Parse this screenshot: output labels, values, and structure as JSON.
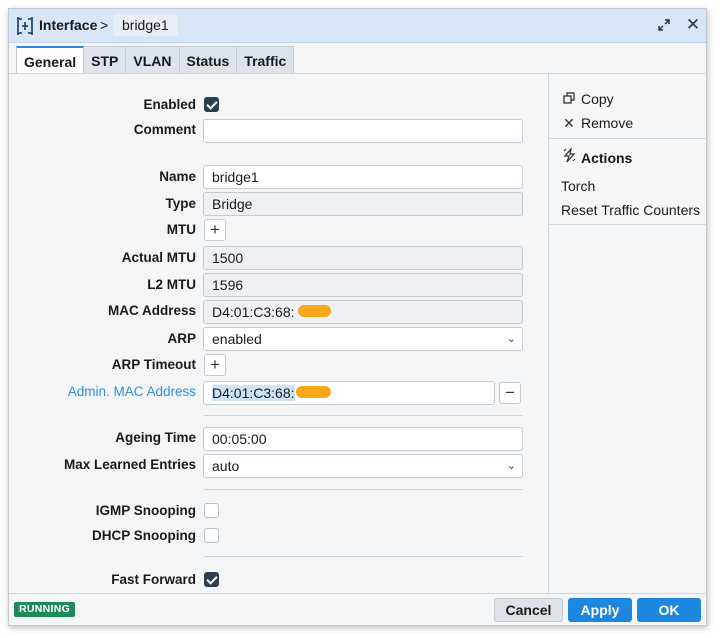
{
  "titlebar": {
    "title": "Interface",
    "separator": ">",
    "item": "bridge1",
    "icon": "interface-icon",
    "expand_icon": "expand-icon",
    "close_icon": "close-icon"
  },
  "tabs": [
    {
      "label": "General",
      "active": true
    },
    {
      "label": "STP",
      "active": false
    },
    {
      "label": "VLAN",
      "active": false
    },
    {
      "label": "Status",
      "active": false
    },
    {
      "label": "Traffic",
      "active": false
    }
  ],
  "form": {
    "enabled": {
      "label": "Enabled",
      "checked": true
    },
    "comment": {
      "label": "Comment",
      "value": ""
    },
    "name": {
      "label": "Name",
      "value": "bridge1"
    },
    "type": {
      "label": "Type",
      "value": "Bridge"
    },
    "mtu": {
      "label": "MTU",
      "button": "+"
    },
    "actual_mtu": {
      "label": "Actual MTU",
      "value": "1500"
    },
    "l2_mtu": {
      "label": "L2 MTU",
      "value": "1596"
    },
    "mac_address": {
      "label": "MAC Address",
      "value": "D4:01:C3:68:"
    },
    "arp": {
      "label": "ARP",
      "value": "enabled",
      "arrow": "⌄"
    },
    "arp_timeout": {
      "label": "ARP Timeout",
      "button": "+"
    },
    "admin_mac": {
      "label": "Admin. MAC Address",
      "value": "D4:01:C3:68:",
      "button": "−"
    },
    "ageing_time": {
      "label": "Ageing Time",
      "value": "00:05:00"
    },
    "max_learned": {
      "label": "Max Learned Entries",
      "value": "auto",
      "arrow": "⌄"
    },
    "igmp": {
      "label": "IGMP Snooping",
      "checked": false
    },
    "dhcp": {
      "label": "DHCP Snooping",
      "checked": false
    },
    "fast_forward": {
      "label": "Fast Forward",
      "checked": true
    }
  },
  "side": {
    "copy": {
      "label": "Copy",
      "icon": "copy-icon"
    },
    "remove": {
      "label": "Remove",
      "icon": "close-icon"
    },
    "actions_heading": {
      "label": "Actions",
      "icon": "lightning-icon"
    },
    "torch": {
      "label": "Torch"
    },
    "reset": {
      "label": "Reset Traffic Counters"
    }
  },
  "footer": {
    "status": "RUNNING",
    "cancel": "Cancel",
    "apply": "Apply",
    "ok": "OK"
  },
  "colors": {
    "accent": "#1d86df",
    "link_label": "#2f8fd6",
    "status_green": "#1e8a5a",
    "redaction": "#f6a81a",
    "titlebar": "#d6e6f7"
  }
}
